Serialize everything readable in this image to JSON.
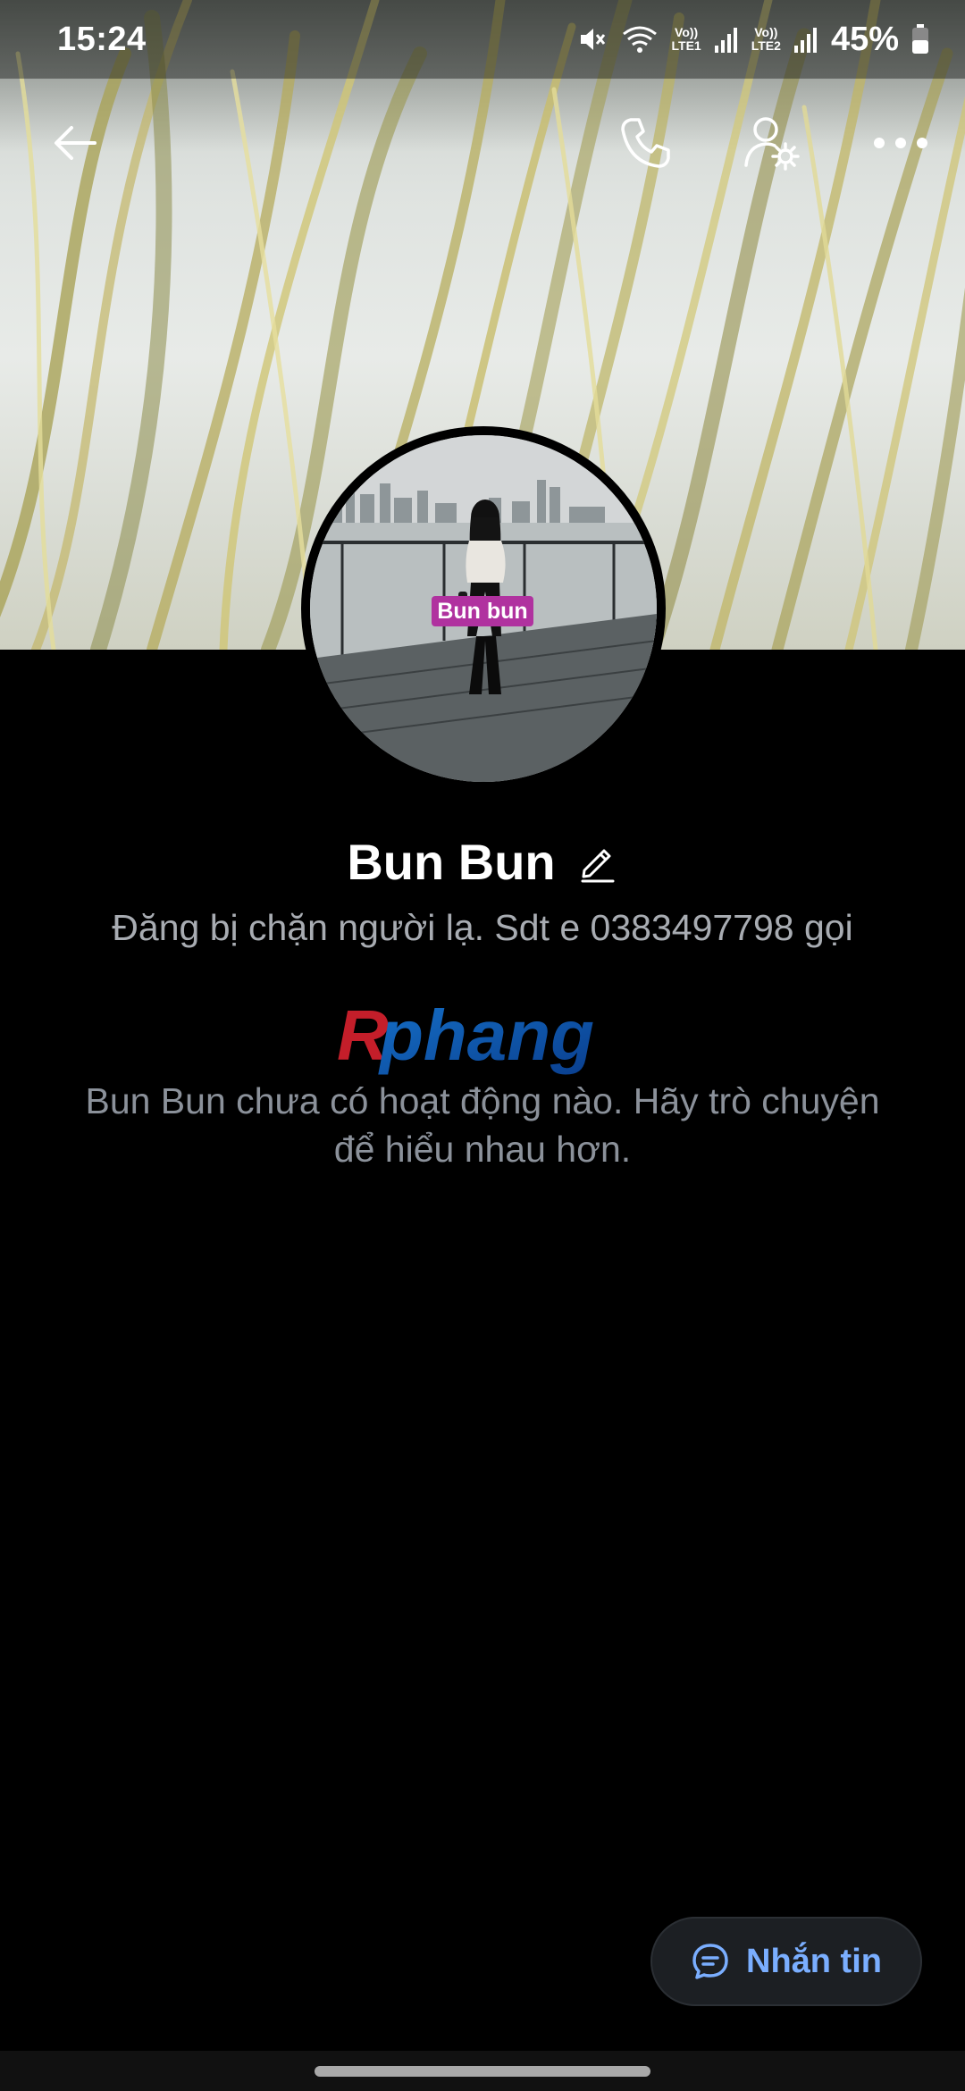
{
  "status_bar": {
    "time": "15:24",
    "network_1": "LTE1",
    "network_2": "LTE2",
    "volte_label": "Vo))",
    "battery_percent": "45%",
    "icons": [
      "mute-icon",
      "wifi-icon",
      "signal-1-icon",
      "signal-2-icon",
      "battery-icon"
    ]
  },
  "toolbar": {
    "icons": [
      "back-arrow-icon",
      "phone-call-icon",
      "profile-settings-icon",
      "more-options-icon"
    ]
  },
  "profile": {
    "avatar_tag": "Bun bun",
    "name": "Bun Bun",
    "bio": "Đăng bị chặn người lạ. Sdt e 0383497798 gọi"
  },
  "watermark": {
    "text_red": "R",
    "text_blue": "phang"
  },
  "feed": {
    "empty_message": "Bun Bun chưa có hoạt động nào. Hãy trò chuyện để hiểu nhau hơn."
  },
  "actions": {
    "message_label": "Nhắn tin"
  },
  "colors": {
    "background": "#000000",
    "accent": "#7aaeff",
    "muted_text": "#8b919a",
    "tag": "#b0329f"
  }
}
